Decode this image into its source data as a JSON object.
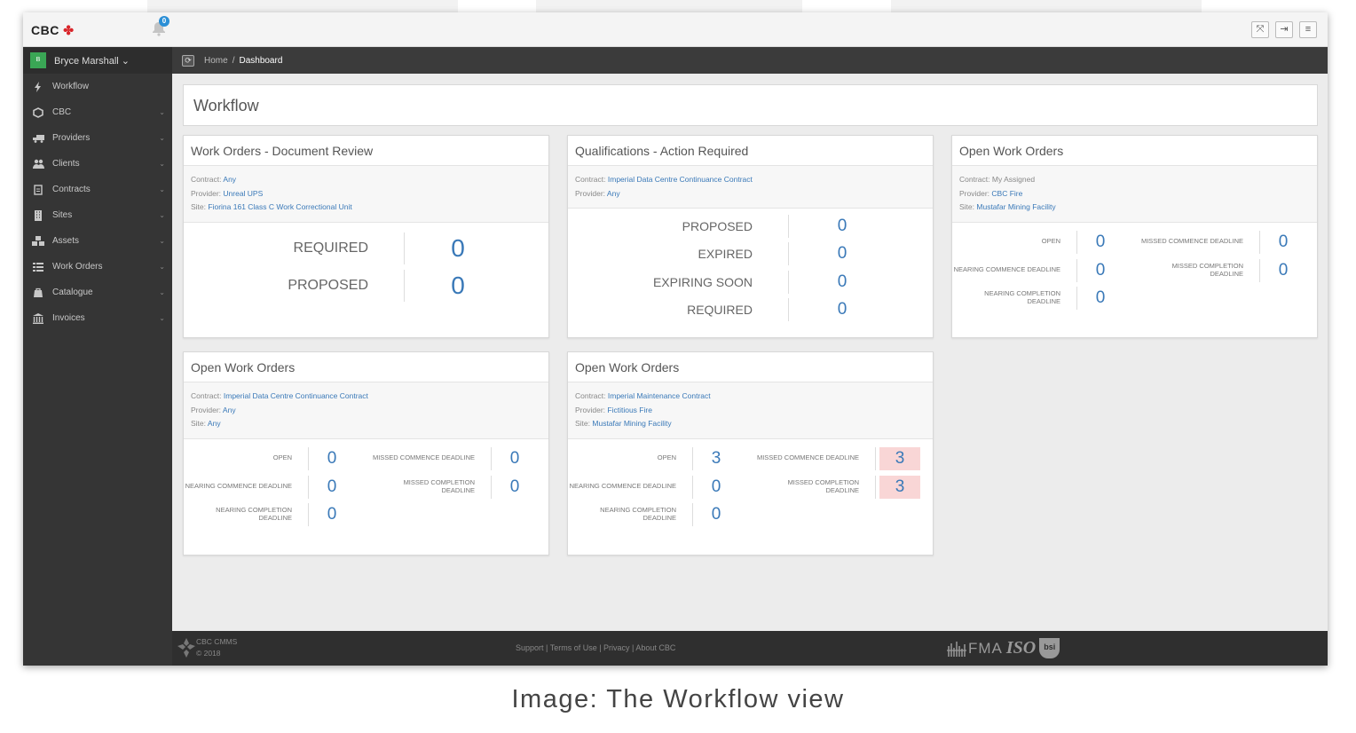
{
  "app": {
    "logo_text": "CBC",
    "notification_count": "0"
  },
  "user": {
    "initial": "B",
    "name": "Bryce Marshall ⌄"
  },
  "sidebar": {
    "items": [
      {
        "label": "Workflow",
        "icon": "bolt-icon",
        "expandable": false
      },
      {
        "label": "CBC",
        "icon": "cube-icon",
        "expandable": true
      },
      {
        "label": "Providers",
        "icon": "truck-icon",
        "expandable": true
      },
      {
        "label": "Clients",
        "icon": "users-icon",
        "expandable": true
      },
      {
        "label": "Contracts",
        "icon": "document-icon",
        "expandable": true
      },
      {
        "label": "Sites",
        "icon": "building-icon",
        "expandable": true
      },
      {
        "label": "Assets",
        "icon": "cubes-icon",
        "expandable": true
      },
      {
        "label": "Work Orders",
        "icon": "list-icon",
        "expandable": true
      },
      {
        "label": "Catalogue",
        "icon": "catalogue-icon",
        "expandable": true
      },
      {
        "label": "Invoices",
        "icon": "bank-icon",
        "expandable": true
      }
    ]
  },
  "breadcrumb": {
    "home": "Home",
    "separator": "/",
    "current": "Dashboard"
  },
  "page": {
    "title": "Workflow"
  },
  "cards": {
    "doc_review": {
      "title": "Work Orders - Document Review",
      "contract_label": "Contract:",
      "contract_value": "Any",
      "provider_label": "Provider:",
      "provider_value": "Unreal UPS",
      "site_label": "Site:",
      "site_value": "Fiorina 161 Class C Work Correctional Unit",
      "rows": [
        {
          "label": "REQUIRED",
          "value": "0"
        },
        {
          "label": "PROPOSED",
          "value": "0"
        }
      ]
    },
    "qualifications": {
      "title": "Qualifications - Action Required",
      "contract_label": "Contract:",
      "contract_value": "Imperial Data Centre Continuance Contract",
      "provider_label": "Provider:",
      "provider_value": "Any",
      "rows": [
        {
          "label": "PROPOSED",
          "value": "0"
        },
        {
          "label": "EXPIRED",
          "value": "0"
        },
        {
          "label": "EXPIRING SOON",
          "value": "0"
        },
        {
          "label": "REQUIRED",
          "value": "0"
        }
      ]
    },
    "open_wo_1": {
      "title": "Open Work Orders",
      "contract_label": "Contract:",
      "contract_value": "My Assigned",
      "provider_label": "Provider:",
      "provider_value": "CBC Fire",
      "site_label": "Site:",
      "site_value": "Mustafar Mining Facility",
      "open_label": "OPEN",
      "open": "0",
      "nearing_commence_label": "NEARING COMMENCE DEADLINE",
      "nearing_commence": "0",
      "nearing_completion_label": "NEARING COMPLETION DEADLINE",
      "nearing_completion": "0",
      "missed_commence_label": "MISSED COMMENCE DEADLINE",
      "missed_commence": "0",
      "missed_completion_label": "MISSED COMPLETION DEADLINE",
      "missed_completion": "0"
    },
    "open_wo_2": {
      "title": "Open Work Orders",
      "contract_label": "Contract:",
      "contract_value": "Imperial Data Centre Continuance Contract",
      "provider_label": "Provider:",
      "provider_value": "Any",
      "site_label": "Site:",
      "site_value": "Any",
      "open_label": "OPEN",
      "open": "0",
      "nearing_commence_label": "NEARING COMMENCE DEADLINE",
      "nearing_commence": "0",
      "nearing_completion_label": "NEARING COMPLETION DEADLINE",
      "nearing_completion": "0",
      "missed_commence_label": "MISSED COMMENCE DEADLINE",
      "missed_commence": "0",
      "missed_completion_label": "MISSED COMPLETION DEADLINE",
      "missed_completion": "0"
    },
    "open_wo_3": {
      "title": "Open Work Orders",
      "contract_label": "Contract:",
      "contract_value": "Imperial Maintenance Contract",
      "provider_label": "Provider:",
      "provider_value": "Fictitious Fire",
      "site_label": "Site:",
      "site_value": "Mustafar Mining Facility",
      "open_label": "OPEN",
      "open": "3",
      "nearing_commence_label": "NEARING COMMENCE DEADLINE",
      "nearing_commence": "0",
      "nearing_completion_label": "NEARING COMPLETION DEADLINE",
      "nearing_completion": "0",
      "missed_commence_label": "MISSED COMMENCE DEADLINE",
      "missed_commence": "3",
      "missed_completion_label": "MISSED COMPLETION DEADLINE",
      "missed_completion": "3"
    }
  },
  "footer": {
    "app_name": "CBC CMMS",
    "copyright": "© 2018",
    "links": "Support | Terms of Use | Privacy | About CBC",
    "cert_1": "FMA",
    "cert_2": "ISO",
    "cert_3": "bsi"
  },
  "caption": "Image: The Workflow view",
  "colors": {
    "accent": "#3a79b8",
    "alert_bg": "#f9d6d6",
    "sidebar": "#353535",
    "brand_red": "#d9252a"
  }
}
